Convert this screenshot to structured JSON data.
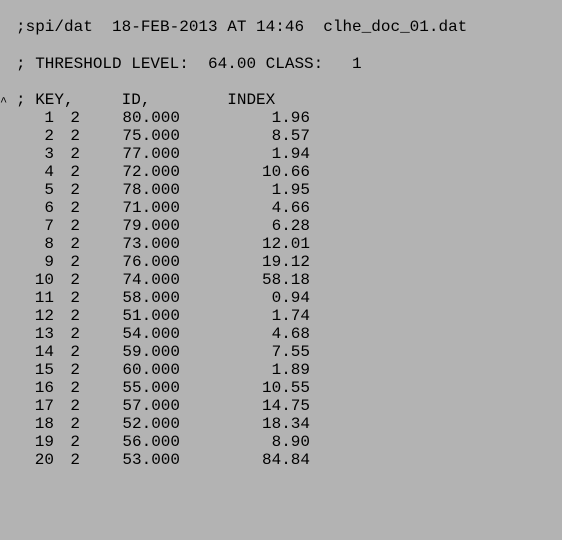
{
  "header": {
    "line": ";spi/dat  18-FEB-2013 AT 14:46  clhe_doc_01.dat"
  },
  "threshold": {
    "line": "; THRESHOLD LEVEL:  64.00 CLASS:   1"
  },
  "columns": {
    "line": "; KEY,     ID,        INDEX"
  },
  "marker": {
    "glyph": "^"
  },
  "rows": [
    {
      "key": "1",
      "cls": "2",
      "id": "80.000",
      "index": "1.96"
    },
    {
      "key": "2",
      "cls": "2",
      "id": "75.000",
      "index": "8.57"
    },
    {
      "key": "3",
      "cls": "2",
      "id": "77.000",
      "index": "1.94"
    },
    {
      "key": "4",
      "cls": "2",
      "id": "72.000",
      "index": "10.66"
    },
    {
      "key": "5",
      "cls": "2",
      "id": "78.000",
      "index": "1.95"
    },
    {
      "key": "6",
      "cls": "2",
      "id": "71.000",
      "index": "4.66"
    },
    {
      "key": "7",
      "cls": "2",
      "id": "79.000",
      "index": "6.28"
    },
    {
      "key": "8",
      "cls": "2",
      "id": "73.000",
      "index": "12.01"
    },
    {
      "key": "9",
      "cls": "2",
      "id": "76.000",
      "index": "19.12"
    },
    {
      "key": "10",
      "cls": "2",
      "id": "74.000",
      "index": "58.18"
    },
    {
      "key": "11",
      "cls": "2",
      "id": "58.000",
      "index": "0.94"
    },
    {
      "key": "12",
      "cls": "2",
      "id": "51.000",
      "index": "1.74"
    },
    {
      "key": "13",
      "cls": "2",
      "id": "54.000",
      "index": "4.68"
    },
    {
      "key": "14",
      "cls": "2",
      "id": "59.000",
      "index": "7.55"
    },
    {
      "key": "15",
      "cls": "2",
      "id": "60.000",
      "index": "1.89"
    },
    {
      "key": "16",
      "cls": "2",
      "id": "55.000",
      "index": "10.55"
    },
    {
      "key": "17",
      "cls": "2",
      "id": "57.000",
      "index": "14.75"
    },
    {
      "key": "18",
      "cls": "2",
      "id": "52.000",
      "index": "18.34"
    },
    {
      "key": "19",
      "cls": "2",
      "id": "56.000",
      "index": "8.90"
    },
    {
      "key": "20",
      "cls": "2",
      "id": "53.000",
      "index": "84.84"
    }
  ],
  "colors": {
    "background": "#b3b3b3",
    "text": "#000000"
  }
}
